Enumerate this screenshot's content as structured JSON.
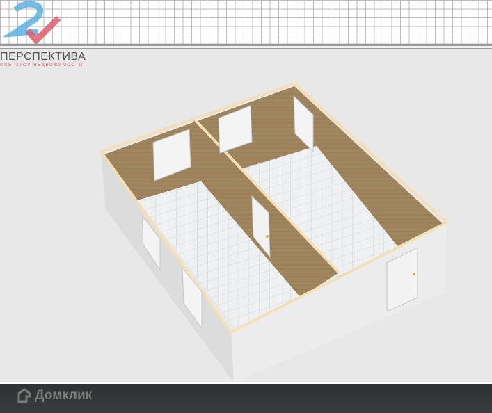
{
  "logo": {
    "brand": "ПЕРСПЕКТИВА",
    "tagline": "ОПЕРАТОР НЕДВИЖИМОСТИ",
    "colors": {
      "blue": "#5ab0e0",
      "red": "#e05c6c"
    }
  },
  "watermark": {
    "text": "Домклик"
  },
  "colors": {
    "wall_wood": "#a0865e",
    "floor": "#eef0f2",
    "outer_wall": "#e2e2e2",
    "background": "#e8e8e8"
  }
}
